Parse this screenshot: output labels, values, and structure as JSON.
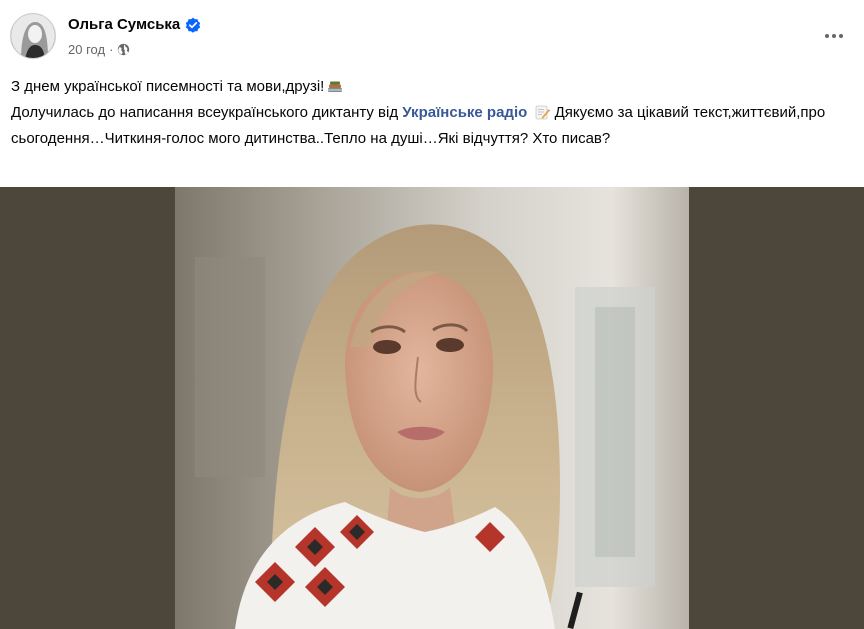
{
  "post": {
    "author_name": "Ольга Сумська",
    "timestamp": "20 год",
    "separator": "·",
    "line1": "З днем української писемності та мови,друзі!",
    "line2_prefix": "Долучилась до написання всеукраїнського диктанту від ",
    "line2_link": "Українське радіо",
    "line2_suffix": " Дякуємо за цікавий текст,життєвий,про сьогодення…Читкиня-голос мого дитинства..Тепло на душі…Які відчуття? Хто писав?"
  },
  "icons": {
    "verified": "verified-badge-icon",
    "audience": "globe-icon",
    "more": "more-options-icon",
    "books": "books-emoji",
    "memo": "memo-emoji"
  },
  "colors": {
    "link": "#385898",
    "verified": "#0866ff",
    "photo_band": "#4d473b",
    "secondary_text": "#65676b"
  }
}
